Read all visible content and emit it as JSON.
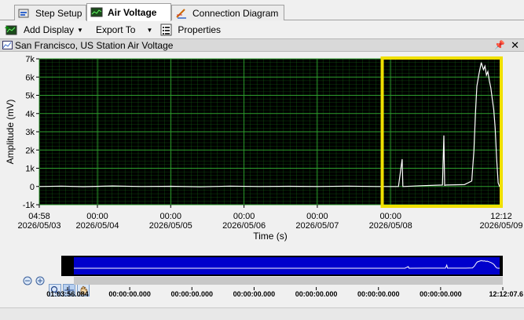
{
  "tabs": [
    {
      "label": "Step Setup",
      "icon": "step-setup-icon"
    },
    {
      "label": "Air Voltage",
      "icon": "monitor-icon",
      "active": true
    },
    {
      "label": "Connection Diagram",
      "icon": "pen-icon"
    }
  ],
  "toolbar": {
    "add_display": "Add Display",
    "export_to": "Export To",
    "properties": "Properties"
  },
  "panel": {
    "title": "San Francisco, US Station Air Voltage"
  },
  "chart_data": {
    "type": "line",
    "ylabel": "Amplitude (mV)",
    "xlabel": "Time (s)",
    "y_ticks": [
      "7k",
      "6k",
      "5k",
      "4k",
      "3k",
      "2k",
      "1k",
      "0",
      "-1k"
    ],
    "y_tick_values": [
      7000,
      6000,
      5000,
      4000,
      3000,
      2000,
      1000,
      0,
      -1000
    ],
    "ylim": [
      -1000,
      7000
    ],
    "x_ticks": [
      {
        "time": "04:58",
        "date": "2026/05/03"
      },
      {
        "time": "00:00",
        "date": "2026/05/04"
      },
      {
        "time": "00:00",
        "date": "2026/05/05"
      },
      {
        "time": "00:00",
        "date": "2026/05/06"
      },
      {
        "time": "00:00",
        "date": "2026/05/07"
      },
      {
        "time": "00:00",
        "date": "2026/05/08"
      },
      {
        "time": "12:12",
        "date": "2026/05/09"
      }
    ],
    "x_tick_days": [
      0,
      0.793,
      1.793,
      2.793,
      3.793,
      4.793,
      6.302
    ],
    "xlim_days": [
      0,
      6.302
    ],
    "grid": true,
    "background": "#000000",
    "grid_color": "#1a7a1a",
    "line_color": "#ffffff",
    "highlight_color": "#f0e000",
    "highlight_days": [
      4.7,
      6.302
    ],
    "series": [
      {
        "x_days": [
          0,
          0.3,
          0.6,
          1.0,
          1.4,
          1.8,
          2.2,
          2.6,
          3.0,
          3.4,
          3.8,
          4.2,
          4.6,
          4.9,
          4.95,
          4.96,
          4.97,
          5.2,
          5.5,
          5.52,
          5.53,
          5.55,
          5.8,
          5.9,
          5.93,
          5.95,
          5.97,
          6.0,
          6.03,
          6.06,
          6.08,
          6.1,
          6.12,
          6.14,
          6.16,
          6.18,
          6.2,
          6.22,
          6.24,
          6.26,
          6.28,
          6.302
        ],
        "values": [
          0,
          20,
          -10,
          30,
          0,
          10,
          -20,
          20,
          0,
          10,
          0,
          20,
          0,
          0,
          1500,
          0,
          0,
          40,
          80,
          2800,
          60,
          80,
          100,
          300,
          2000,
          4000,
          5500,
          6200,
          6800,
          6400,
          6600,
          6100,
          6300,
          5800,
          5400,
          4800,
          4200,
          3200,
          1500,
          200,
          0,
          0
        ]
      }
    ]
  },
  "overview": {
    "times": [
      "01:03:56.084",
      "00:00:00.000",
      "00:00:00.000",
      "00:00:00.000",
      "00:00:00.000",
      "00:00:00.000",
      "00:00:00.000",
      "12:12:07.6"
    ],
    "fill_color": "#0000cc"
  }
}
